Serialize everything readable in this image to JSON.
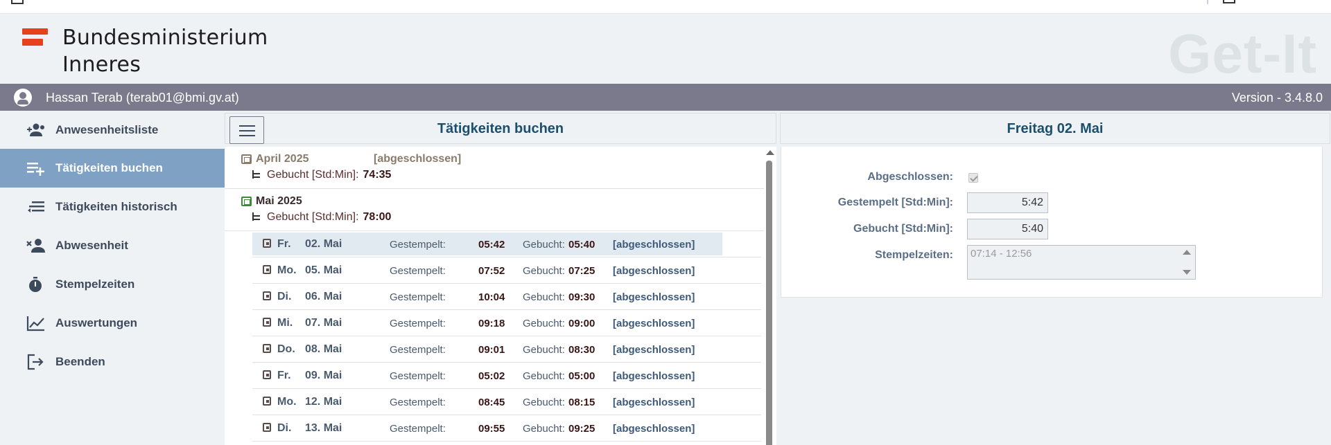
{
  "header": {
    "brand_line1": "Bundesministerium",
    "brand_line2": "Inneres",
    "product": "Get-It",
    "brand_color": "#e8401c"
  },
  "userbar": {
    "user": "Hassan Terab (terab01@bmi.gv.at)",
    "version": "Version - 3.4.8.0",
    "icon": "user-circle-icon"
  },
  "sidebar": {
    "items": [
      {
        "label": "Anwesenheitsliste",
        "icon": "people-add-icon",
        "active": false
      },
      {
        "label": "Tätigkeiten buchen",
        "icon": "list-add-icon",
        "active": true
      },
      {
        "label": "Tätigkeiten historisch",
        "icon": "list-history-icon",
        "active": false
      },
      {
        "label": "Abwesenheit",
        "icon": "person-remove-icon",
        "active": false
      },
      {
        "label": "Stempelzeiten",
        "icon": "stopwatch-icon",
        "active": false
      },
      {
        "label": "Auswertungen",
        "icon": "line-chart-icon",
        "active": false
      },
      {
        "label": "Beenden",
        "icon": "logout-icon",
        "active": false
      }
    ]
  },
  "list_panel": {
    "title": "Tätigkeiten buchen",
    "months": [
      {
        "name": "April 2025",
        "status": "[abgeschlossen]",
        "sum_label": "Gebucht [Std:Min]:",
        "sum_value": "74:35",
        "color": "#8a7a6a"
      },
      {
        "name": "Mai 2025",
        "status": "",
        "sum_label": "Gebucht [Std:Min]:",
        "sum_value": "78:00",
        "color": "#3a2a2a"
      }
    ],
    "days": [
      {
        "weekday": "Fr.",
        "date": "02. Mai",
        "gestempelt_label": "Gestempelt:",
        "gestempelt": "05:42",
        "gebucht_label": "Gebucht:",
        "gebucht": "05:40",
        "status": "[abgeschlossen]",
        "selected": true
      },
      {
        "weekday": "Mo.",
        "date": "05. Mai",
        "gestempelt_label": "Gestempelt:",
        "gestempelt": "07:52",
        "gebucht_label": "Gebucht:",
        "gebucht": "07:25",
        "status": "[abgeschlossen]",
        "selected": false
      },
      {
        "weekday": "Di.",
        "date": "06. Mai",
        "gestempelt_label": "Gestempelt:",
        "gestempelt": "10:04",
        "gebucht_label": "Gebucht:",
        "gebucht": "09:30",
        "status": "[abgeschlossen]",
        "selected": false
      },
      {
        "weekday": "Mi.",
        "date": "07. Mai",
        "gestempelt_label": "Gestempelt:",
        "gestempelt": "09:18",
        "gebucht_label": "Gebucht:",
        "gebucht": "09:00",
        "status": "[abgeschlossen]",
        "selected": false
      },
      {
        "weekday": "Do.",
        "date": "08. Mai",
        "gestempelt_label": "Gestempelt:",
        "gestempelt": "09:01",
        "gebucht_label": "Gebucht:",
        "gebucht": "08:30",
        "status": "[abgeschlossen]",
        "selected": false
      },
      {
        "weekday": "Fr.",
        "date": "09. Mai",
        "gestempelt_label": "Gestempelt:",
        "gestempelt": "05:02",
        "gebucht_label": "Gebucht:",
        "gebucht": "05:00",
        "status": "[abgeschlossen]",
        "selected": false
      },
      {
        "weekday": "Mo.",
        "date": "12. Mai",
        "gestempelt_label": "Gestempelt:",
        "gestempelt": "08:45",
        "gebucht_label": "Gebucht:",
        "gebucht": "08:15",
        "status": "[abgeschlossen]",
        "selected": false
      },
      {
        "weekday": "Di.",
        "date": "13. Mai",
        "gestempelt_label": "Gestempelt:",
        "gestempelt": "09:55",
        "gebucht_label": "Gebucht:",
        "gebucht": "09:25",
        "status": "[abgeschlossen]",
        "selected": false
      }
    ]
  },
  "detail_panel": {
    "title": "Freitag 02. Mai",
    "abgeschlossen_label": "Abgeschlossen:",
    "abgeschlossen_checked": true,
    "gestempelt_label": "Gestempelt [Std:Min]:",
    "gestempelt_value": "5:42",
    "gebucht_label": "Gebucht [Std:Min]:",
    "gebucht_value": "5:40",
    "stempelzeiten_label": "Stempelzeiten:",
    "stempelzeiten_value": "07:14 - 12:56"
  }
}
